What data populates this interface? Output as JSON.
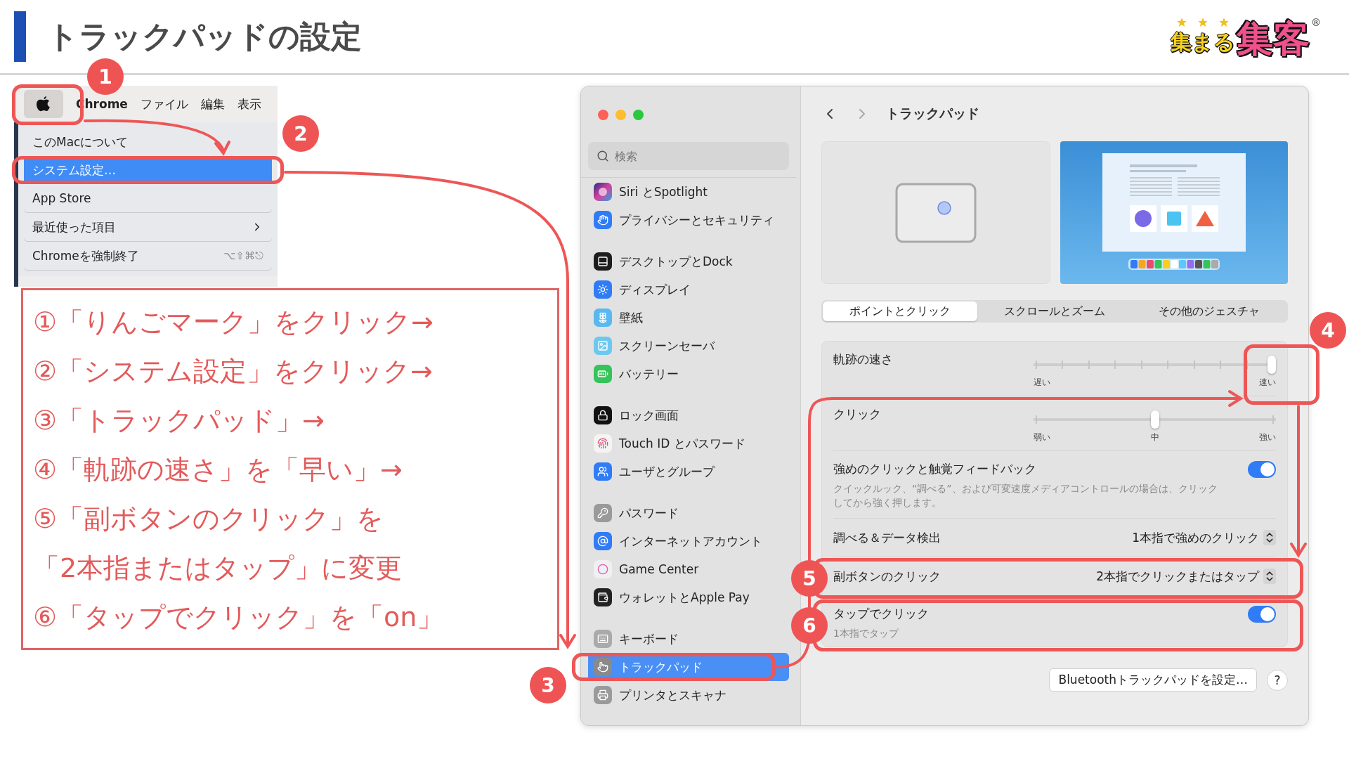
{
  "header": {
    "title": "トラックパッドの設定",
    "logo": {
      "small": "集まる",
      "large": "集客",
      "mark": "®"
    }
  },
  "menu_screenshot": {
    "apple_selected": true,
    "app": "Chrome",
    "menus": [
      "ファイル",
      "編集",
      "表示"
    ],
    "items": [
      {
        "label": "このMacについて",
        "selected": false,
        "separator_after": false
      },
      {
        "label": "システム設定…",
        "selected": true,
        "separator_after": false
      },
      {
        "label": "App Store",
        "selected": false,
        "separator_after": true
      },
      {
        "label": "最近使った項目",
        "selected": false,
        "separator_after": true,
        "submenu": true
      },
      {
        "label": "Chromeを強制終了",
        "selected": false,
        "separator_after": true,
        "shortcut": "⌥⇧⌘⎋"
      }
    ]
  },
  "instructions": [
    "①「りんごマーク」をクリック→",
    "②「システム設定」をクリック→",
    "③「トラックパッド」→",
    "④「軌跡の速さ」を「早い」→",
    "⑤「副ボタンのクリック」を",
    "「2本指またはタップ」に変更",
    "⑥「タップでクリック」を「on」"
  ],
  "settings_window": {
    "search": {
      "placeholder": "検索"
    },
    "sidebar": {
      "groups": [
        [
          {
            "label": "Siri とSpotlight",
            "selected": false
          },
          {
            "label": "プライバシーとセキュリティ",
            "selected": false
          }
        ],
        [
          {
            "label": "デスクトップとDock",
            "selected": false
          },
          {
            "label": "ディスプレイ",
            "selected": false
          },
          {
            "label": "壁紙",
            "selected": false
          },
          {
            "label": "スクリーンセーバ",
            "selected": false
          },
          {
            "label": "バッテリー",
            "selected": false
          }
        ],
        [
          {
            "label": "ロック画面",
            "selected": false
          },
          {
            "label": "Touch ID とパスワード",
            "selected": false
          },
          {
            "label": "ユーザとグループ",
            "selected": false
          }
        ],
        [
          {
            "label": "パスワード",
            "selected": false
          },
          {
            "label": "インターネットアカウント",
            "selected": false
          },
          {
            "label": "Game Center",
            "selected": false
          },
          {
            "label": "ウォレットとApple Pay",
            "selected": false
          }
        ],
        [
          {
            "label": "キーボード",
            "selected": false
          },
          {
            "label": "トラックパッド",
            "selected": true
          },
          {
            "label": "プリンタとスキャナ",
            "selected": false
          }
        ]
      ]
    },
    "title": "トラックパッド",
    "tabs": [
      {
        "label": "ポイントとクリック",
        "selected": true
      },
      {
        "label": "スクロールとズーム",
        "selected": false
      },
      {
        "label": "その他のジェスチャ",
        "selected": false
      }
    ],
    "rows": [
      {
        "kind": "tick-slider",
        "label": "軌跡の速さ",
        "level": 1,
        "scale_labels": [
          "遅い",
          "速い"
        ]
      },
      {
        "kind": "step-slider",
        "label": "クリック",
        "level": 0.5,
        "scale_labels": [
          "弱い",
          "中",
          "強い"
        ]
      },
      {
        "kind": "toggle",
        "label": "強めのクリックと触覚フィードバック",
        "description": "クイックルック、“調べる”、および可変速度メディアコントロールの場合は、クリックしてから強く押します。",
        "on": true
      },
      {
        "kind": "popup",
        "label": "調べる＆データ検出",
        "value": "1本指で強めのクリック"
      },
      {
        "kind": "popup",
        "label": "副ボタンのクリック",
        "value": "2本指でクリックまたはタップ"
      },
      {
        "kind": "toggle",
        "label": "タップでクリック",
        "description": "1本指でタップ",
        "on": true
      }
    ],
    "footer": {
      "bluetooth_button": "Bluetoothトラックパッドを設定…",
      "help_button": "?"
    }
  },
  "step_badges": [
    "1",
    "2",
    "3",
    "4",
    "5",
    "6"
  ]
}
